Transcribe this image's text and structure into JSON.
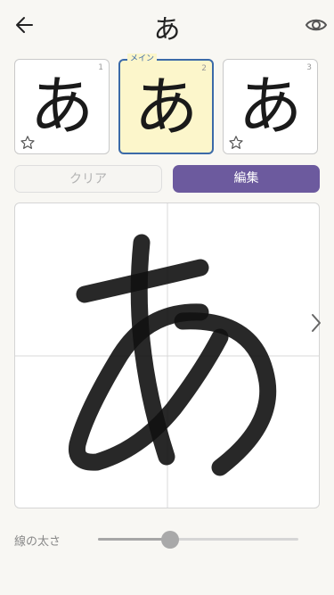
{
  "header": {
    "title": "あ",
    "back_icon": "arrow-left-icon",
    "preview_icon": "eye-icon"
  },
  "variants": [
    {
      "number": "1",
      "glyph": "あ",
      "selected": false,
      "star_icon": "star-outline-icon"
    },
    {
      "number": "2",
      "glyph": "あ",
      "selected": true,
      "tag": "メイン"
    },
    {
      "number": "3",
      "glyph": "あ",
      "selected": false,
      "star_icon": "star-outline-icon"
    }
  ],
  "actions": {
    "clear_label": "クリア",
    "edit_label": "編集"
  },
  "canvas": {
    "next_icon": "chevron-right-icon"
  },
  "stroke_width": {
    "label": "線の太さ",
    "value_fraction": 0.36
  },
  "colors": {
    "accent": "#6c5a9e",
    "selected_bg": "#fcf6cb",
    "selected_border": "#3b6aa8",
    "background": "#f8f7f3"
  }
}
